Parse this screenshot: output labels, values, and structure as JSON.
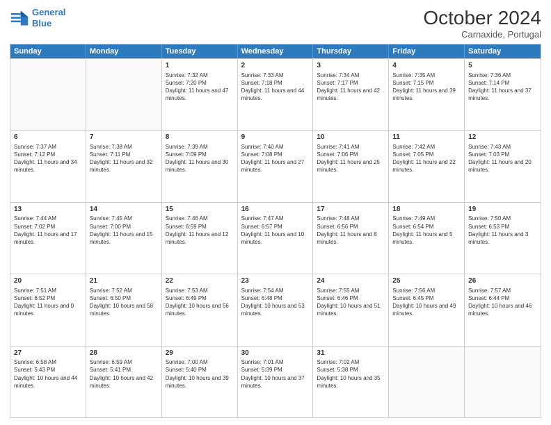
{
  "header": {
    "logo_line1": "General",
    "logo_line2": "Blue",
    "month": "October 2024",
    "location": "Carnaxide, Portugal"
  },
  "days_of_week": [
    "Sunday",
    "Monday",
    "Tuesday",
    "Wednesday",
    "Thursday",
    "Friday",
    "Saturday"
  ],
  "weeks": [
    [
      {
        "day": "",
        "empty": true
      },
      {
        "day": "",
        "empty": true
      },
      {
        "day": "1",
        "sunrise": "Sunrise: 7:32 AM",
        "sunset": "Sunset: 7:20 PM",
        "daylight": "Daylight: 11 hours and 47 minutes."
      },
      {
        "day": "2",
        "sunrise": "Sunrise: 7:33 AM",
        "sunset": "Sunset: 7:18 PM",
        "daylight": "Daylight: 11 hours and 44 minutes."
      },
      {
        "day": "3",
        "sunrise": "Sunrise: 7:34 AM",
        "sunset": "Sunset: 7:17 PM",
        "daylight": "Daylight: 11 hours and 42 minutes."
      },
      {
        "day": "4",
        "sunrise": "Sunrise: 7:35 AM",
        "sunset": "Sunset: 7:15 PM",
        "daylight": "Daylight: 11 hours and 39 minutes."
      },
      {
        "day": "5",
        "sunrise": "Sunrise: 7:36 AM",
        "sunset": "Sunset: 7:14 PM",
        "daylight": "Daylight: 11 hours and 37 minutes."
      }
    ],
    [
      {
        "day": "6",
        "sunrise": "Sunrise: 7:37 AM",
        "sunset": "Sunset: 7:12 PM",
        "daylight": "Daylight: 11 hours and 34 minutes."
      },
      {
        "day": "7",
        "sunrise": "Sunrise: 7:38 AM",
        "sunset": "Sunset: 7:11 PM",
        "daylight": "Daylight: 11 hours and 32 minutes."
      },
      {
        "day": "8",
        "sunrise": "Sunrise: 7:39 AM",
        "sunset": "Sunset: 7:09 PM",
        "daylight": "Daylight: 11 hours and 30 minutes."
      },
      {
        "day": "9",
        "sunrise": "Sunrise: 7:40 AM",
        "sunset": "Sunset: 7:08 PM",
        "daylight": "Daylight: 11 hours and 27 minutes."
      },
      {
        "day": "10",
        "sunrise": "Sunrise: 7:41 AM",
        "sunset": "Sunset: 7:06 PM",
        "daylight": "Daylight: 11 hours and 25 minutes."
      },
      {
        "day": "11",
        "sunrise": "Sunrise: 7:42 AM",
        "sunset": "Sunset: 7:05 PM",
        "daylight": "Daylight: 11 hours and 22 minutes."
      },
      {
        "day": "12",
        "sunrise": "Sunrise: 7:43 AM",
        "sunset": "Sunset: 7:03 PM",
        "daylight": "Daylight: 11 hours and 20 minutes."
      }
    ],
    [
      {
        "day": "13",
        "sunrise": "Sunrise: 7:44 AM",
        "sunset": "Sunset: 7:02 PM",
        "daylight": "Daylight: 11 hours and 17 minutes."
      },
      {
        "day": "14",
        "sunrise": "Sunrise: 7:45 AM",
        "sunset": "Sunset: 7:00 PM",
        "daylight": "Daylight: 11 hours and 15 minutes."
      },
      {
        "day": "15",
        "sunrise": "Sunrise: 7:46 AM",
        "sunset": "Sunset: 6:59 PM",
        "daylight": "Daylight: 11 hours and 12 minutes."
      },
      {
        "day": "16",
        "sunrise": "Sunrise: 7:47 AM",
        "sunset": "Sunset: 6:57 PM",
        "daylight": "Daylight: 11 hours and 10 minutes."
      },
      {
        "day": "17",
        "sunrise": "Sunrise: 7:48 AM",
        "sunset": "Sunset: 6:56 PM",
        "daylight": "Daylight: 11 hours and 8 minutes."
      },
      {
        "day": "18",
        "sunrise": "Sunrise: 7:49 AM",
        "sunset": "Sunset: 6:54 PM",
        "daylight": "Daylight: 11 hours and 5 minutes."
      },
      {
        "day": "19",
        "sunrise": "Sunrise: 7:50 AM",
        "sunset": "Sunset: 6:53 PM",
        "daylight": "Daylight: 11 hours and 3 minutes."
      }
    ],
    [
      {
        "day": "20",
        "sunrise": "Sunrise: 7:51 AM",
        "sunset": "Sunset: 6:52 PM",
        "daylight": "Daylight: 11 hours and 0 minutes."
      },
      {
        "day": "21",
        "sunrise": "Sunrise: 7:52 AM",
        "sunset": "Sunset: 6:50 PM",
        "daylight": "Daylight: 10 hours and 58 minutes."
      },
      {
        "day": "22",
        "sunrise": "Sunrise: 7:53 AM",
        "sunset": "Sunset: 6:49 PM",
        "daylight": "Daylight: 10 hours and 56 minutes."
      },
      {
        "day": "23",
        "sunrise": "Sunrise: 7:54 AM",
        "sunset": "Sunset: 6:48 PM",
        "daylight": "Daylight: 10 hours and 53 minutes."
      },
      {
        "day": "24",
        "sunrise": "Sunrise: 7:55 AM",
        "sunset": "Sunset: 6:46 PM",
        "daylight": "Daylight: 10 hours and 51 minutes."
      },
      {
        "day": "25",
        "sunrise": "Sunrise: 7:56 AM",
        "sunset": "Sunset: 6:45 PM",
        "daylight": "Daylight: 10 hours and 49 minutes."
      },
      {
        "day": "26",
        "sunrise": "Sunrise: 7:57 AM",
        "sunset": "Sunset: 6:44 PM",
        "daylight": "Daylight: 10 hours and 46 minutes."
      }
    ],
    [
      {
        "day": "27",
        "sunrise": "Sunrise: 6:58 AM",
        "sunset": "Sunset: 5:43 PM",
        "daylight": "Daylight: 10 hours and 44 minutes."
      },
      {
        "day": "28",
        "sunrise": "Sunrise: 6:59 AM",
        "sunset": "Sunset: 5:41 PM",
        "daylight": "Daylight: 10 hours and 42 minutes."
      },
      {
        "day": "29",
        "sunrise": "Sunrise: 7:00 AM",
        "sunset": "Sunset: 5:40 PM",
        "daylight": "Daylight: 10 hours and 39 minutes."
      },
      {
        "day": "30",
        "sunrise": "Sunrise: 7:01 AM",
        "sunset": "Sunset: 5:39 PM",
        "daylight": "Daylight: 10 hours and 37 minutes."
      },
      {
        "day": "31",
        "sunrise": "Sunrise: 7:02 AM",
        "sunset": "Sunset: 5:38 PM",
        "daylight": "Daylight: 10 hours and 35 minutes."
      },
      {
        "day": "",
        "empty": true
      },
      {
        "day": "",
        "empty": true
      }
    ]
  ]
}
